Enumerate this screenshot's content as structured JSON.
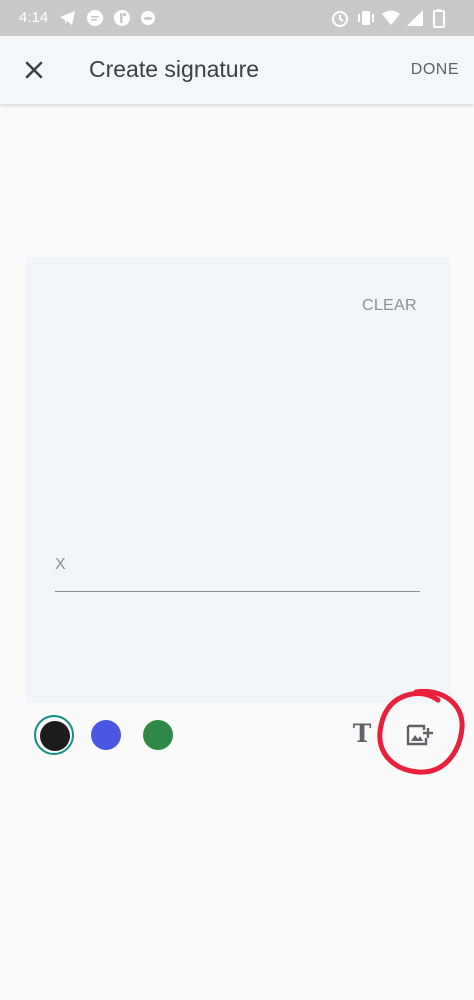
{
  "status_bar": {
    "time": "4:14",
    "icons": [
      "telegram-icon",
      "chat-icon",
      "app-icon",
      "gamepad-icon",
      "alarm-icon",
      "vibrate-icon",
      "wifi-icon",
      "signal-icon",
      "battery-icon"
    ]
  },
  "app_bar": {
    "title": "Create signature",
    "done_label": "DONE",
    "close_icon": "close-icon"
  },
  "signature_pad": {
    "clear_label": "CLEAR",
    "sign_mark": "X"
  },
  "colors": {
    "accent": "#138e83",
    "swatches": [
      "#1c1c1c",
      "#4a57e2",
      "#2e8a46"
    ],
    "selected": "#1c1c1c"
  },
  "tools": {
    "text_tool_label": "T",
    "image_tool_icon": "add-image-icon"
  }
}
